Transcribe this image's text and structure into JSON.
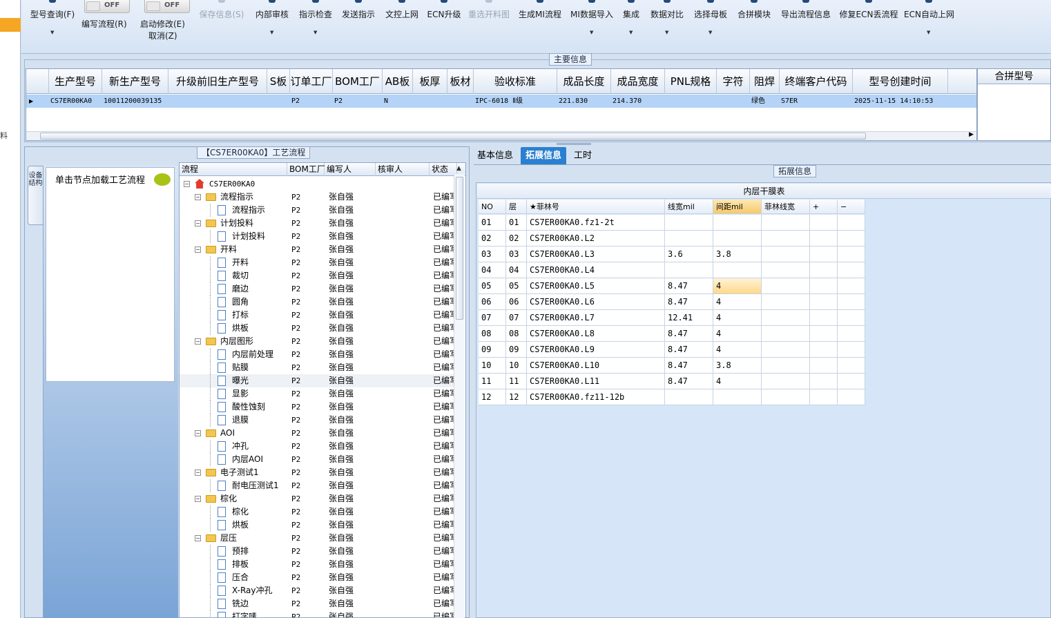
{
  "left_strip": {
    "char": "料"
  },
  "toolbar": {
    "query_model": "型号查询(F)",
    "write_flow": "编写流程(R)",
    "write_flow_toggle": "OFF",
    "start_modify": "启动修改(E)",
    "start_modify_toggle": "OFF",
    "cancel": "取消(Z)",
    "save_info": "保存信息(S)",
    "internal_review": "内部审核",
    "instruction_check": "指示检查",
    "send_instruction": "发送指示",
    "doc_online": "文控上网",
    "ecn_upgrade": "ECN升级",
    "reselect_cutting": "重选开料图",
    "generate_mi_flow": "生成MI流程",
    "mi_data_import": "MI数据导入",
    "integrate": "集成",
    "data_compare": "数据对比",
    "select_mother": "选择母板",
    "merge_module": "合拼模块",
    "export_flow_info": "导出流程信息",
    "repair_ecn": "修复ECN丢流程",
    "ecn_auto_online": "ECN自动上网"
  },
  "main_info": {
    "title": "主要信息",
    "columns": [
      "生产型号",
      "新生产型号",
      "升级前旧生产型号",
      "S板",
      "订单工厂",
      "BOM工厂",
      "AB板",
      "板厚",
      "板材",
      "验收标准",
      "成品长度",
      "成品宽度",
      "PNL规格",
      "字符",
      "阻焊",
      "终端客户代码",
      "型号创建时间"
    ],
    "row": [
      "CS7ER00KA0",
      "10011200039135",
      "",
      "",
      "P2",
      "P2",
      "N",
      "",
      "",
      "IPC-6018 Ⅱ级",
      "221.830",
      "214.370",
      "",
      "",
      "绿色",
      "S7ER",
      "2025-11-15 14:10:53"
    ],
    "merge_header": "合拼型号"
  },
  "process": {
    "title": "【CS7ER00KA0】工艺流程",
    "vertical_tab": "设备结构",
    "hint": "单击节点加载工艺流程",
    "columns": [
      "流程",
      "BOM工厂",
      "编写人",
      "核审人",
      "状态"
    ],
    "rows": [
      {
        "name": "CS7ER00KA0",
        "level": 0,
        "type": "root",
        "factory": "",
        "writer": "",
        "reviewer": "",
        "status": ""
      },
      {
        "name": "流程指示",
        "level": 1,
        "type": "folder",
        "factory": "P2",
        "writer": "张自强",
        "reviewer": "",
        "status": "已编写"
      },
      {
        "name": "流程指示",
        "level": 2,
        "type": "doc",
        "factory": "P2",
        "writer": "张自强",
        "reviewer": "",
        "status": "已编写"
      },
      {
        "name": "计划投料",
        "level": 1,
        "type": "folder",
        "factory": "P2",
        "writer": "张自强",
        "reviewer": "",
        "status": "已编写"
      },
      {
        "name": "计划投料",
        "level": 2,
        "type": "doc",
        "factory": "P2",
        "writer": "张自强",
        "reviewer": "",
        "status": "已编写"
      },
      {
        "name": "开料",
        "level": 1,
        "type": "folder",
        "factory": "P2",
        "writer": "张自强",
        "reviewer": "",
        "status": "已编写"
      },
      {
        "name": "开料",
        "level": 2,
        "type": "doc",
        "factory": "P2",
        "writer": "张自强",
        "reviewer": "",
        "status": "已编写"
      },
      {
        "name": "裁切",
        "level": 2,
        "type": "doc",
        "factory": "P2",
        "writer": "张自强",
        "reviewer": "",
        "status": "已编写"
      },
      {
        "name": "磨边",
        "level": 2,
        "type": "doc",
        "factory": "P2",
        "writer": "张自强",
        "reviewer": "",
        "status": "已编写"
      },
      {
        "name": "圆角",
        "level": 2,
        "type": "doc",
        "factory": "P2",
        "writer": "张自强",
        "reviewer": "",
        "status": "已编写"
      },
      {
        "name": "打标",
        "level": 2,
        "type": "doc",
        "factory": "P2",
        "writer": "张自强",
        "reviewer": "",
        "status": "已编写"
      },
      {
        "name": "烘板",
        "level": 2,
        "type": "doc",
        "factory": "P2",
        "writer": "张自强",
        "reviewer": "",
        "status": "已编写"
      },
      {
        "name": "内层图形",
        "level": 1,
        "type": "folder",
        "factory": "P2",
        "writer": "张自强",
        "reviewer": "",
        "status": "已编写"
      },
      {
        "name": "内层前处理",
        "level": 2,
        "type": "doc",
        "factory": "P2",
        "writer": "张自强",
        "reviewer": "",
        "status": "已编写"
      },
      {
        "name": "贴膜",
        "level": 2,
        "type": "doc",
        "factory": "P2",
        "writer": "张自强",
        "reviewer": "",
        "status": "已编写"
      },
      {
        "name": "曝光",
        "level": 2,
        "type": "doc",
        "factory": "P2",
        "writer": "张自强",
        "reviewer": "",
        "status": "已编写",
        "selected": true
      },
      {
        "name": "显影",
        "level": 2,
        "type": "doc",
        "factory": "P2",
        "writer": "张自强",
        "reviewer": "",
        "status": "已编写"
      },
      {
        "name": "酸性蚀刻",
        "level": 2,
        "type": "doc",
        "factory": "P2",
        "writer": "张自强",
        "reviewer": "",
        "status": "已编写"
      },
      {
        "name": "退膜",
        "level": 2,
        "type": "doc",
        "factory": "P2",
        "writer": "张自强",
        "reviewer": "",
        "status": "已编写"
      },
      {
        "name": "AOI",
        "level": 1,
        "type": "folder",
        "factory": "P2",
        "writer": "张自强",
        "reviewer": "",
        "status": "已编写"
      },
      {
        "name": "冲孔",
        "level": 2,
        "type": "doc",
        "factory": "P2",
        "writer": "张自强",
        "reviewer": "",
        "status": "已编写"
      },
      {
        "name": "内层AOI",
        "level": 2,
        "type": "doc",
        "factory": "P2",
        "writer": "张自强",
        "reviewer": "",
        "status": "已编写"
      },
      {
        "name": "电子测试1",
        "level": 1,
        "type": "folder",
        "factory": "P2",
        "writer": "张自强",
        "reviewer": "",
        "status": "已编写"
      },
      {
        "name": "耐电压测试1",
        "level": 2,
        "type": "doc",
        "factory": "P2",
        "writer": "张自强",
        "reviewer": "",
        "status": "已编写"
      },
      {
        "name": "棕化",
        "level": 1,
        "type": "folder",
        "factory": "P2",
        "writer": "张自强",
        "reviewer": "",
        "status": "已编写"
      },
      {
        "name": "棕化",
        "level": 2,
        "type": "doc",
        "factory": "P2",
        "writer": "张自强",
        "reviewer": "",
        "status": "已编写"
      },
      {
        "name": "烘板",
        "level": 2,
        "type": "doc",
        "factory": "P2",
        "writer": "张自强",
        "reviewer": "",
        "status": "已编写"
      },
      {
        "name": "层压",
        "level": 1,
        "type": "folder",
        "factory": "P2",
        "writer": "张自强",
        "reviewer": "",
        "status": "已编写"
      },
      {
        "name": "预排",
        "level": 2,
        "type": "doc",
        "factory": "P2",
        "writer": "张自强",
        "reviewer": "",
        "status": "已编写"
      },
      {
        "name": "排板",
        "level": 2,
        "type": "doc",
        "factory": "P2",
        "writer": "张自强",
        "reviewer": "",
        "status": "已编写"
      },
      {
        "name": "压合",
        "level": 2,
        "type": "doc",
        "factory": "P2",
        "writer": "张自强",
        "reviewer": "",
        "status": "已编写"
      },
      {
        "name": "X-Ray冲孔",
        "level": 2,
        "type": "doc",
        "factory": "P2",
        "writer": "张自强",
        "reviewer": "",
        "status": "已编写"
      },
      {
        "name": "铣边",
        "level": 2,
        "type": "doc",
        "factory": "P2",
        "writer": "张自强",
        "reviewer": "",
        "status": "已编写"
      },
      {
        "name": "打字唛",
        "level": 2,
        "type": "doc",
        "factory": "P2",
        "writer": "张自强",
        "reviewer": "",
        "status": "已编写"
      }
    ]
  },
  "tabs": [
    "基本信息",
    "拓展信息",
    "工时"
  ],
  "active_tab": 1,
  "ext": {
    "group_title": "拓展信息",
    "table_title": "内层干膜表",
    "columns": [
      "NO",
      "层",
      "★菲林号",
      "线宽mil",
      "间距mil",
      "菲林线宽",
      "+",
      "−"
    ],
    "rows": [
      [
        "01",
        "01",
        "CS7ER00KA0.fz1-2t",
        "",
        "",
        "",
        "",
        ""
      ],
      [
        "02",
        "02",
        "CS7ER00KA0.L2",
        "",
        "",
        "",
        "",
        ""
      ],
      [
        "03",
        "03",
        "CS7ER00KA0.L3",
        "3.6",
        "3.8",
        "",
        "",
        ""
      ],
      [
        "04",
        "04",
        "CS7ER00KA0.L4",
        "",
        "",
        "",
        "",
        ""
      ],
      [
        "05",
        "05",
        "CS7ER00KA0.L5",
        "8.47",
        "4",
        "",
        "",
        ""
      ],
      [
        "06",
        "06",
        "CS7ER00KA0.L6",
        "8.47",
        "4",
        "",
        "",
        ""
      ],
      [
        "07",
        "07",
        "CS7ER00KA0.L7",
        "12.41",
        "4",
        "",
        "",
        ""
      ],
      [
        "08",
        "08",
        "CS7ER00KA0.L8",
        "8.47",
        "4",
        "",
        "",
        ""
      ],
      [
        "09",
        "09",
        "CS7ER00KA0.L9",
        "8.47",
        "4",
        "",
        "",
        ""
      ],
      [
        "10",
        "10",
        "CS7ER00KA0.L10",
        "8.47",
        "3.8",
        "",
        "",
        ""
      ],
      [
        "11",
        "11",
        "CS7ER00KA0.L11",
        "8.47",
        "4",
        "",
        "",
        ""
      ],
      [
        "12",
        "12",
        "CS7ER00KA0.fz11-12b",
        "",
        "",
        "",
        "",
        ""
      ]
    ],
    "highlight_column": 4,
    "highlight_row": 4
  },
  "colors": {
    "accent": "#2b7fd0",
    "selected_row": "#b4d3f7",
    "highlight": "#f7c96a",
    "bg": "#d4e1f1"
  }
}
